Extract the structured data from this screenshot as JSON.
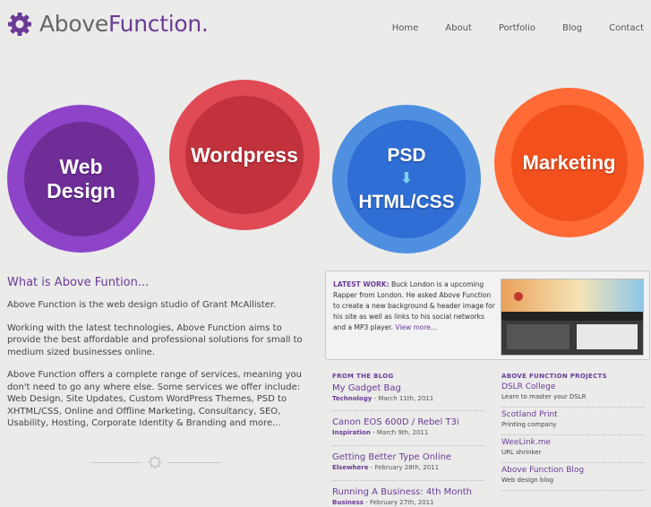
{
  "header": {
    "logo_light": "Above",
    "logo_strong": "Function.",
    "nav": [
      "Home",
      "About",
      "Portfolio",
      "Blog",
      "Contact"
    ]
  },
  "services": {
    "web_design": [
      "Web",
      "Design"
    ],
    "wordpress": "Wordpress",
    "psd": "PSD",
    "html_css": "HTML/CSS",
    "marketing": "Marketing"
  },
  "intro": {
    "title": "What is Above Funtion...",
    "p1": "Above Function is the web design studio of Grant McAllister.",
    "p2": "Working with the latest technologies, Above Function aims to provide the best affordable and professional solutions for small to medium sized businesses online.",
    "p3": "Above Function offers a complete range of services, meaning you don't need to go any where else. Some services we offer include: Web Design, Site Updates, Custom WordPress Themes, PSD to XHTML/CSS, Online and Offline Marketing, Consultancy, SEO, Usability, Hosting, Corporate Identity & Branding and more..."
  },
  "latest_work": {
    "label": "LATEST WORK:",
    "text": "Buck London is a upcoming Rapper from London. He asked Above Function to create a new background & header image for his site as well as links to his social networks and a MP3 player.",
    "more": "View more..."
  },
  "blog": {
    "heading": "FROM THE BLOG",
    "posts": [
      {
        "title": "My Gadget Bag",
        "category": "Technology",
        "date": "- March 11th, 2011"
      },
      {
        "title": "Canon EOS 600D / Rebel T3i",
        "category": "Inspiration",
        "date": "- March 9th, 2011"
      },
      {
        "title": "Getting Better Type Online",
        "category": "Elsewhere",
        "date": "- February 28th, 2011"
      },
      {
        "title": "Running A Business: 4th Month",
        "category": "Business",
        "date": "- February 27th, 2011"
      }
    ]
  },
  "projects": {
    "heading": "ABOVE FUNCTION PROJECTS",
    "items": [
      {
        "title": "DSLR College",
        "desc": "Learn to master your DSLR"
      },
      {
        "title": "Scotland Print",
        "desc": "Printing company"
      },
      {
        "title": "WeeLink.me",
        "desc": "URL shrinker"
      },
      {
        "title": "Above Function Blog",
        "desc": "Web design blog"
      }
    ]
  },
  "colors": {
    "brand_purple": "#6b3b96",
    "purple_circle": "#8e44c8",
    "red_circle": "#e04a55",
    "blue_circle": "#4f8fe0",
    "orange_circle": "#ff6a35"
  },
  "icons": {
    "logo": "gear-icon",
    "divider": "gear-icon",
    "psd_to_html": "arrow-down-icon"
  }
}
